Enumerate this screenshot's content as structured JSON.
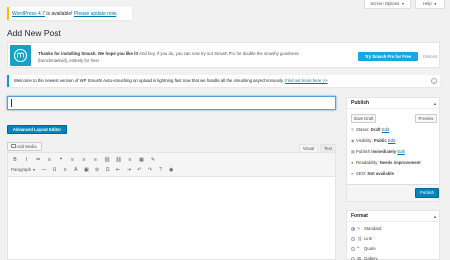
{
  "update_nag": {
    "version_text": "WordPress 4.7",
    "middle_text": " is available! ",
    "link_text": "Please update now",
    "end_text": "."
  },
  "screen_meta": {
    "screen_options": "Screen Options",
    "help": "Help"
  },
  "page": {
    "title": "Add New Post"
  },
  "smush_notice": {
    "bold": "Thanks for installing Smush. We hope you like it!",
    "body": " And hey, if you do, you can now try out Smush Pro for double the smushy goodness (benchmarked), entirely for free!",
    "cta": "Try Smush Pro for Free",
    "dismiss": "Dismiss",
    "brand_color": "#17a8e3"
  },
  "welcome_notice": {
    "text": "Welcome to the newest version of WP Smush! Auto-smushing on upload is lightning fast now that we handle all the smushing asynchronously. ",
    "link": "Find out more here >>"
  },
  "editor": {
    "advanced_layout_editor": "Advanced Layout Editor",
    "add_media": "Add Media",
    "tab_visual": "Visual",
    "tab_text": "Text",
    "paragraph": "Paragraph",
    "toolbar_row1": [
      "B",
      "I",
      "≔",
      "≡",
      "❝",
      "≡",
      "≡",
      "≡",
      "⛓",
      "⛓",
      "≡",
      "▦",
      "✎"
    ],
    "toolbar_row2": [
      "—",
      "U",
      "≡",
      "A",
      "▣",
      "⊘",
      "Ω",
      "⇤",
      "⇥",
      "↶",
      "↷",
      "?",
      "◉"
    ]
  },
  "publish": {
    "header": "Publish",
    "save_draft": "Save Draft",
    "preview": "Preview",
    "status_label": "Status: ",
    "status_value": "Draft",
    "status_link": "Edit",
    "visibility_label": "Visibility: ",
    "visibility_value": "Public",
    "visibility_link": "Edit",
    "schedule_label": "Publish ",
    "schedule_value": "immediately",
    "schedule_link": "Edit",
    "readability_label": "Readability: ",
    "readability_value": "Needs improvement",
    "seo_label": "SEO: ",
    "seo_value": "Not available",
    "publish_button": "Publish",
    "primary_color": "#0085ba"
  },
  "format": {
    "header": "Format",
    "options": [
      {
        "label": "Standard",
        "icon": "pin-icon",
        "selected": true
      },
      {
        "label": "Link",
        "icon": "link-icon",
        "selected": false
      },
      {
        "label": "Quote",
        "icon": "quote-icon",
        "selected": false
      },
      {
        "label": "Gallery",
        "icon": "gallery-icon",
        "selected": false
      }
    ]
  }
}
